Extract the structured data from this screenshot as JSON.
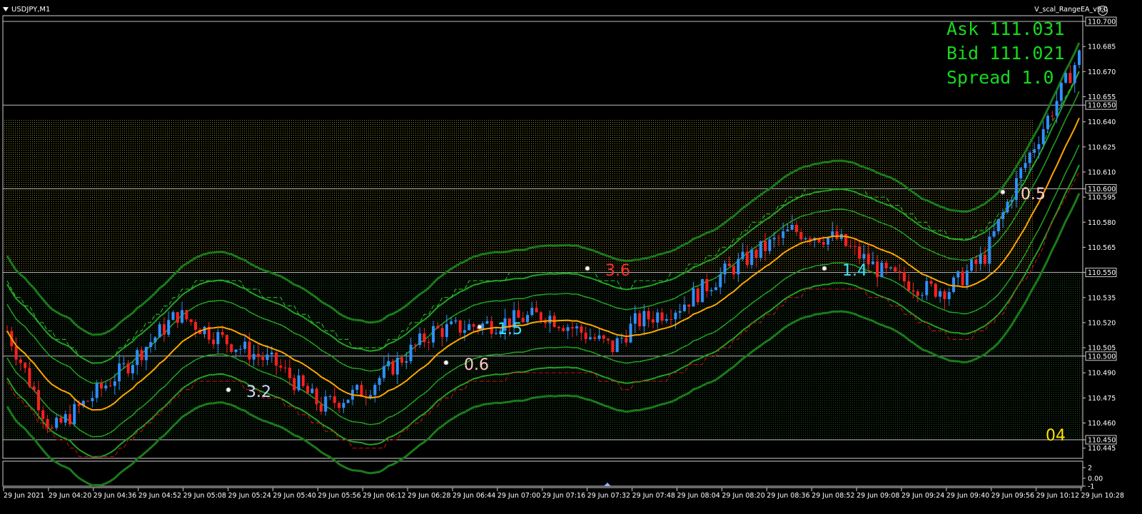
{
  "window": {
    "symbol_title": "USDJPY,M1",
    "ea_name": "V_scal_RangeEA_v9.0",
    "ea_icon": "smiley-icon"
  },
  "info_panel": {
    "ask": "Ask 111.031",
    "bid": "Bid 111.021",
    "spread": "Spread 1.0"
  },
  "corner_label": "04",
  "colors": {
    "bull": "#2f8fff",
    "bear": "#ff2020",
    "ma": "#ffa500",
    "band_dark": "#1a7a1a",
    "band_light": "#22a022",
    "info_text": "#17d91c",
    "zone_dots": "#8a8a1e"
  },
  "price_axis": {
    "labels": [
      "110.700",
      "110.685",
      "110.670",
      "110.655",
      "110.650",
      "110.640",
      "110.625",
      "110.610",
      "110.600",
      "110.595",
      "110.580",
      "110.565",
      "110.550",
      "110.535",
      "110.520",
      "110.505",
      "110.500",
      "110.490",
      "110.475",
      "110.460",
      "110.450",
      "110.445"
    ],
    "values": [
      110.7,
      110.685,
      110.67,
      110.655,
      110.65,
      110.64,
      110.625,
      110.61,
      110.6,
      110.595,
      110.58,
      110.565,
      110.55,
      110.535,
      110.52,
      110.505,
      110.5,
      110.49,
      110.475,
      110.46,
      110.45,
      110.445
    ],
    "boxed": [
      "110.700",
      "110.650",
      "110.600",
      "110.550",
      "110.500",
      "110.450"
    ]
  },
  "horizontal_levels": [
    110.7,
    110.65,
    110.6,
    110.55,
    110.5,
    110.45
  ],
  "time_axis": [
    "29 Jun 2021",
    "29 Jun 04:20",
    "29 Jun 04:36",
    "29 Jun 04:52",
    "29 Jun 05:08",
    "29 Jun 05:24",
    "29 Jun 05:40",
    "29 Jun 05:56",
    "29 Jun 06:12",
    "29 Jun 06:28",
    "29 Jun 06:44",
    "29 Jun 07:00",
    "29 Jun 07:16",
    "29 Jun 07:32",
    "29 Jun 07:48",
    "29 Jun 08:04",
    "29 Jun 08:20",
    "29 Jun 08:36",
    "29 Jun 08:52",
    "29 Jun 09:08",
    "29 Jun 09:24",
    "29 Jun 09:40",
    "29 Jun 09:56",
    "29 Jun 10:12",
    "29 Jun 10:28"
  ],
  "sub_window": {
    "labels": [
      "2",
      "0.00",
      "-1"
    ]
  },
  "trade_labels": [
    {
      "text": "3.2",
      "color": "#cfd8ff"
    },
    {
      "text": "0.6",
      "color": "#ffc8c8"
    },
    {
      "text": "1.5",
      "color": "#3fe0ff"
    },
    {
      "text": "3.6",
      "color": "#ff3030"
    },
    {
      "text": "1.4",
      "color": "#3fe0ff"
    },
    {
      "text": "0.5",
      "color": "#ffc8c8"
    }
  ]
}
